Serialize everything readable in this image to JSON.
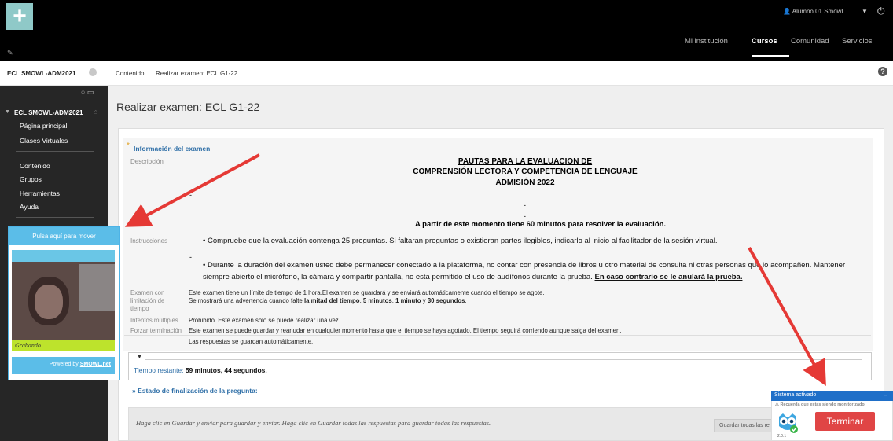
{
  "topbar": {
    "user_name": "Alumno 01 Smowl",
    "nav": [
      "Mi institución",
      "Cursos",
      "Comunidad",
      "Servicios"
    ],
    "active_nav": "Cursos"
  },
  "breadcrumb": {
    "course": "ECL SMOWL-ADM2021",
    "items": [
      "Contenido",
      "Realizar examen: ECL G1-22"
    ]
  },
  "sidebar": {
    "course": "ECL SMOWL-ADM2021",
    "items_top": [
      "Página principal",
      "Clases Virtuales"
    ],
    "items_mid": [
      "Contenido",
      "Grupos",
      "Herramientas",
      "Ayuda"
    ]
  },
  "page": {
    "title": "Realizar examen: ECL G1-22"
  },
  "exam_info": {
    "heading": "Información del examen",
    "description_label": "Descripción",
    "pautas_1": "PAUTAS PARA LA EVALUACION DE",
    "pautas_2": "COMPRENSIÓN LECTORA Y COMPETENCIA DE LENGUAJE",
    "pautas_3": "ADMISIÓN 2022",
    "dash": "-",
    "time_notice": "A partir de este momento tiene 60 minutos para resolver la evaluación.",
    "instructions_label": "Instrucciones",
    "bullet_1": "Compruebe que la evaluación contenga 25 preguntas. Si faltaran preguntas o existieran partes ilegibles, indicarlo al inicio al facilitador de la sesión virtual.",
    "bullet_2": "Durante la duración del examen usted debe permanecer conectado a la plataforma, no contar con presencia de libros u otro material de consulta ni otras personas que lo acompañen. Mantener siempre abierto el micrófono, la cámara y compartir pantalla, no esta permitido el uso de audífonos durante la prueba.",
    "bullet_2_bold": "En caso contrario se le anulará la prueba.",
    "time_limit_label_1": "Examen con",
    "time_limit_label_2": "limitación de",
    "time_limit_label_3": "tiempo",
    "time_limit_text_1": "Este examen tiene un límite de tiempo de 1 hora.El examen se guardará y se enviará automáticamente cuando el tiempo se agote.",
    "time_limit_text_2a": "Se mostrará una advertencia cuando falte ",
    "time_limit_text_2b": "la mitad del tiempo",
    "time_limit_text_2c": ", ",
    "time_limit_text_2d": "5 minutos",
    "time_limit_text_2e": ", ",
    "time_limit_text_2f": "1 minuto",
    "time_limit_text_2g": " y ",
    "time_limit_text_2h": "30 segundos",
    "time_limit_text_2i": ".",
    "multiple_label": "Intentos múltiples",
    "multiple_text": "Prohibido. Este examen solo se puede realizar una vez.",
    "force_label": "Forzar terminación",
    "force_text": "Este examen se puede guardar y reanudar en cualquier momento hasta que el tiempo se haya agotado. El tiempo seguirá corriendo aunque salga del examen.",
    "autosave_text": "Las respuestas se guardan automáticamente."
  },
  "timer": {
    "label": "Tiempo restante: ",
    "value": "59 minutos, 44 segundos."
  },
  "question_status": "Estado de finalización de la pregunta:",
  "bottom": {
    "hint": "Haga clic en Guardar y enviar para guardar y enviar. Haga clic en Guardar todas las respuestas para guardar todas las respuestas.",
    "save_all_label": "Guardar todas las re"
  },
  "smowl_cam": {
    "header": "Pulsa aquí para mover",
    "status": "Grabando",
    "powered_prefix": "Powered by ",
    "powered_brand": "SMOWL.net"
  },
  "smowl_panel": {
    "header": "Sistema activado",
    "minimize": "–",
    "note": "⚠ Recuerda que estas siendo monitorizado",
    "version": "2.0.1",
    "terminate_label": "Terminar"
  },
  "colors": {
    "topbar": "#000000",
    "sidebar": "#262626",
    "accent_blue": "#2f6fa7",
    "smowl_blue": "#5bbde8",
    "recording_green": "#bde32c",
    "terminate_red": "#e04545",
    "annotation_arrow": "#e53935"
  },
  "icons": [
    "plus-logo-icon",
    "user-icon",
    "caret-down-icon",
    "power-icon",
    "help-icon",
    "home-icon",
    "owl-icon"
  ]
}
